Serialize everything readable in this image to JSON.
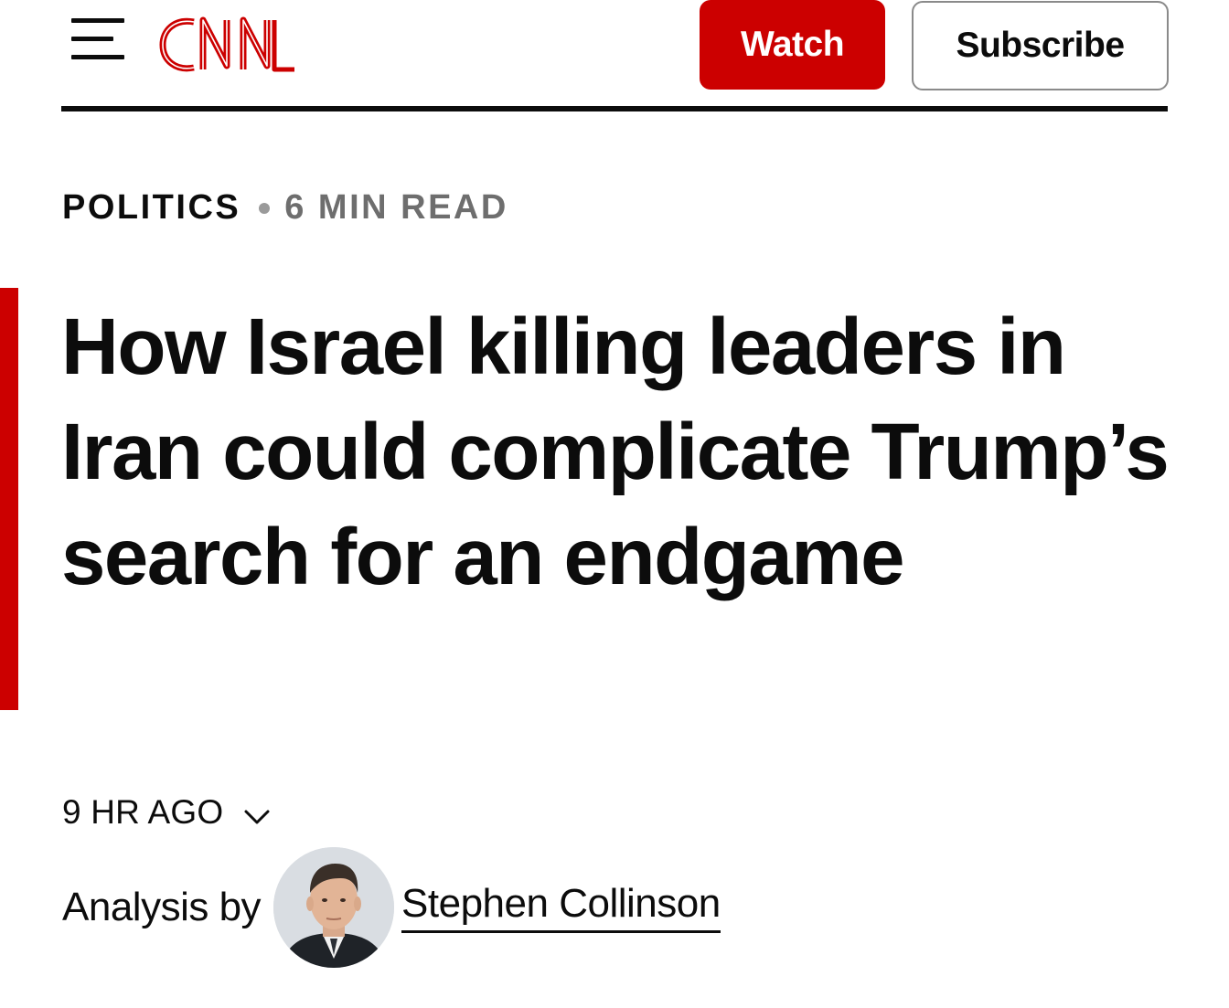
{
  "header": {
    "menu_icon": "hamburger-menu-icon",
    "logo_text": "CNN",
    "brand_color": "#cc0000",
    "watch_label": "Watch",
    "subscribe_label": "Subscribe"
  },
  "article": {
    "section": "POLITICS",
    "read_time": "6 MIN READ",
    "headline": "How Israel killing leaders in Iran could complicate Trump’s search for an endgame",
    "timestamp": "9 HR AGO",
    "byline_prefix": "Analysis by",
    "author": "Stephen Collinson"
  }
}
